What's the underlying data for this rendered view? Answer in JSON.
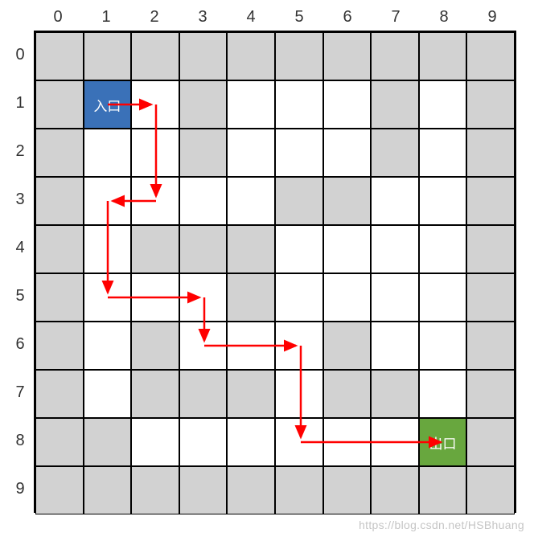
{
  "grid": {
    "cols": [
      "0",
      "1",
      "2",
      "3",
      "4",
      "5",
      "6",
      "7",
      "8",
      "9"
    ],
    "rows": [
      "0",
      "1",
      "2",
      "3",
      "4",
      "5",
      "6",
      "7",
      "8",
      "9"
    ],
    "cells": [
      [
        1,
        1,
        1,
        1,
        1,
        1,
        1,
        1,
        1,
        1
      ],
      [
        1,
        2,
        0,
        1,
        0,
        0,
        0,
        1,
        0,
        1
      ],
      [
        1,
        0,
        0,
        1,
        0,
        0,
        0,
        1,
        0,
        1
      ],
      [
        1,
        0,
        0,
        0,
        0,
        1,
        1,
        0,
        0,
        1
      ],
      [
        1,
        0,
        1,
        1,
        1,
        0,
        0,
        0,
        0,
        1
      ],
      [
        1,
        0,
        0,
        0,
        1,
        0,
        0,
        0,
        0,
        1
      ],
      [
        1,
        0,
        1,
        0,
        0,
        0,
        1,
        0,
        0,
        1
      ],
      [
        1,
        0,
        1,
        1,
        1,
        0,
        1,
        1,
        0,
        1
      ],
      [
        1,
        1,
        0,
        0,
        0,
        0,
        0,
        0,
        3,
        1
      ],
      [
        1,
        1,
        1,
        1,
        1,
        1,
        1,
        1,
        1,
        1
      ]
    ],
    "start_label": "入口",
    "end_label": "出口"
  },
  "path": {
    "segments": [
      [
        [
          1,
          1
        ],
        [
          2,
          1
        ]
      ],
      [
        [
          2,
          1
        ],
        [
          2,
          3
        ]
      ],
      [
        [
          2,
          3
        ],
        [
          1,
          3
        ]
      ],
      [
        [
          1,
          3
        ],
        [
          1,
          5
        ]
      ],
      [
        [
          1,
          5
        ],
        [
          3,
          5
        ]
      ],
      [
        [
          3,
          5
        ],
        [
          3,
          6
        ]
      ],
      [
        [
          3,
          6
        ],
        [
          5,
          6
        ]
      ],
      [
        [
          5,
          6
        ],
        [
          5,
          8
        ]
      ],
      [
        [
          5,
          8
        ],
        [
          8,
          8
        ]
      ]
    ]
  },
  "colors": {
    "wall": "#d2d2d2",
    "open": "#ffffff",
    "start": "#3a71b8",
    "end": "#68a73e",
    "arrow": "#ff0000"
  },
  "watermark": "https://blog.csdn.net/HSBhuang"
}
